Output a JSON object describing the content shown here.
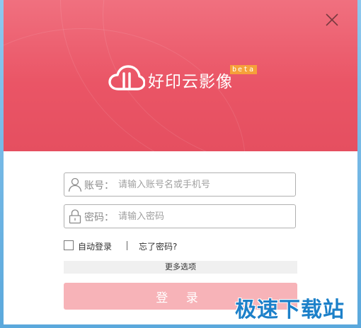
{
  "window": {
    "app_name": "好印云影像",
    "beta_label": "beta",
    "close_icon": "close-icon"
  },
  "colors": {
    "banner": "#ea5566",
    "beta_badge": "#f6a03a",
    "login_button": "#f7b3b8",
    "watermark": "#1c80c9"
  },
  "form": {
    "account": {
      "label": "账号：",
      "placeholder": "请输入账号名或手机号",
      "value": "",
      "icon": "user-icon"
    },
    "password": {
      "label": "密码：",
      "placeholder": "请输入密码",
      "value": "",
      "icon": "lock-icon"
    },
    "auto_login": {
      "label": "自动登录",
      "checked": false
    },
    "forgot_password": "忘了密码?",
    "more_options": "更多选项",
    "login_button": "登 录"
  },
  "watermark": "极速下载站"
}
